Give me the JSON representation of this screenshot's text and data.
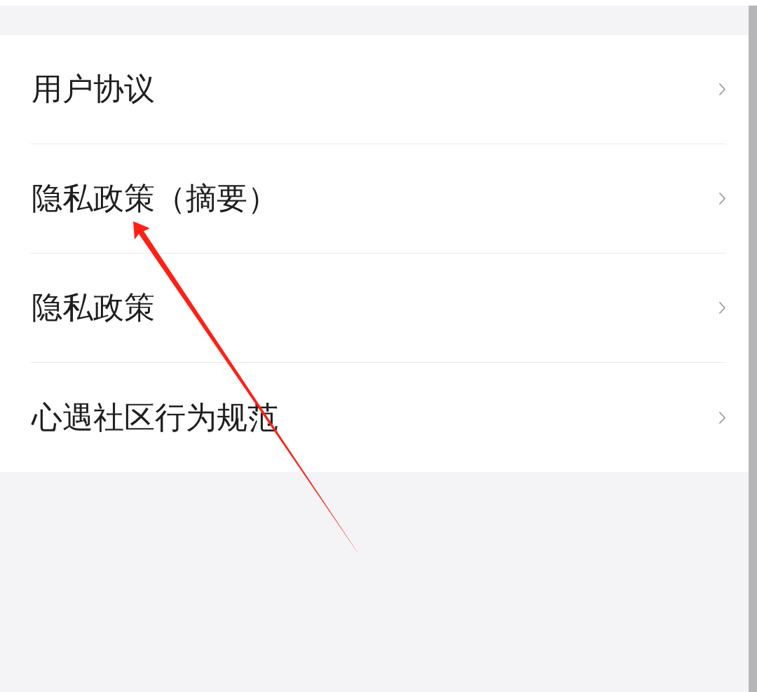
{
  "menu": {
    "items": [
      {
        "label": "用户协议"
      },
      {
        "label": "隐私政策（摘要）"
      },
      {
        "label": "隐私政策"
      },
      {
        "label": "心遇社区行为规范"
      }
    ]
  }
}
